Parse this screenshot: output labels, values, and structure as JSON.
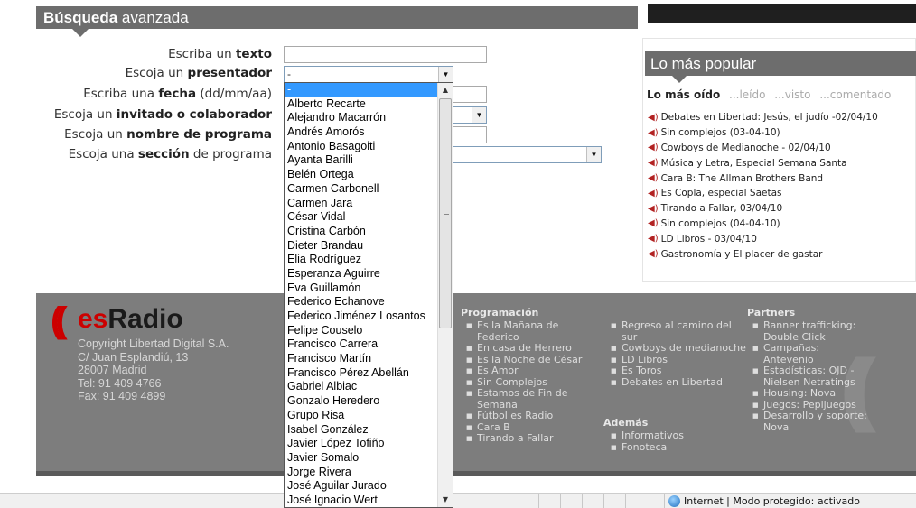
{
  "search": {
    "title_bold": "Búsqueda",
    "title_rest": "avanzada",
    "fields": [
      {
        "pre": "Escriba un",
        "bold": "texto",
        "post": ""
      },
      {
        "pre": "Escoja un",
        "bold": "presentador",
        "post": ""
      },
      {
        "pre": "Escriba una",
        "bold": "fecha",
        "post": "(dd/mm/aa)"
      },
      {
        "pre": "Escoja un",
        "bold": "invitado o colaborador",
        "post": ""
      },
      {
        "pre": "Escoja un",
        "bold": "nombre de programa",
        "post": ""
      },
      {
        "pre": "Escoja una",
        "bold": "sección",
        "post": "de programa"
      }
    ],
    "presenter_value": "-"
  },
  "dropdown": {
    "selected": "-",
    "options": [
      "-",
      "Alberto Recarte",
      "Alejandro Macarrón",
      "Andrés Amorós",
      "Antonio Basagoiti",
      "Ayanta Barilli",
      "Belén Ortega",
      "Carmen Carbonell",
      "Carmen Jara",
      "César Vidal",
      "Cristina Carbón",
      "Dieter Brandau",
      "Elia Rodríguez",
      "Esperanza Aguirre",
      "Eva Guillamón",
      "Federico Echanove",
      "Federico Jiménez Losantos",
      "Felipe Couselo",
      "Francisco Carrera",
      "Francisco Martín",
      "Francisco Pérez Abellán",
      "Gabriel Albiac",
      "Gonzalo Heredero",
      "Grupo Risa",
      "Isabel González",
      "Javier López Tofiño",
      "Javier Somalo",
      "Jorge Rivera",
      "José Aguilar Jurado",
      "José Ignacio Wert"
    ]
  },
  "popular": {
    "title": "Lo más popular",
    "tabs": [
      {
        "label": "Lo más oído",
        "active": true
      },
      {
        "label": "...leído",
        "active": false
      },
      {
        "label": "...visto",
        "active": false
      },
      {
        "label": "...comentado",
        "active": false
      }
    ],
    "items": [
      "Debates en Libertad: Jesús, el judío -02/04/10",
      "Sin complejos (03-04-10)",
      "Cowboys de Medianoche - 02/04/10",
      "Música y Letra, Especial Semana Santa",
      "Cara B: The Allman Brothers Band",
      "Es Copla, especial Saetas",
      "Tirando a Fallar, 03/04/10",
      "Sin complejos (04-04-10)",
      "LD Libros - 03/04/10",
      "Gastronomía y El placer de gastar"
    ]
  },
  "footer": {
    "logo_es": "es",
    "logo_radio": "Radio",
    "contact": [
      "Copyright Libertad Digital S.A.",
      "C/ Juan Esplandiú, 13",
      "28007 Madrid",
      "Tel: 91 409 4766",
      "Fax: 91 409 4899"
    ],
    "programacion_title": "Programación",
    "programacion_col1": [
      "Es la Mañana de Federico",
      "En casa de Herrero",
      "Es la Noche de César",
      "Es Amor",
      "Sin Complejos",
      "Estamos de Fin de Semana",
      "Fútbol es Radio",
      "Cara B",
      "Tirando a Fallar"
    ],
    "programacion_col2": [
      "Regreso al camino del sur",
      "Cowboys de medianoche",
      "LD Libros",
      "Es Toros",
      "Debates en Libertad"
    ],
    "ademas_title": "Además",
    "ademas": [
      "Informativos",
      "Fonoteca"
    ],
    "partners_title": "Partners",
    "partners": [
      "Banner trafficking: Double Click",
      "Campañas: Antevenio",
      "Estadísticas: OJD - Nielsen Netratings",
      "Housing: Nova",
      "Juegos: Pepijuegos",
      "Desarrollo y soporte: Nova"
    ]
  },
  "status_bar": {
    "zone_text": "Internet | Modo protegido: activado"
  }
}
